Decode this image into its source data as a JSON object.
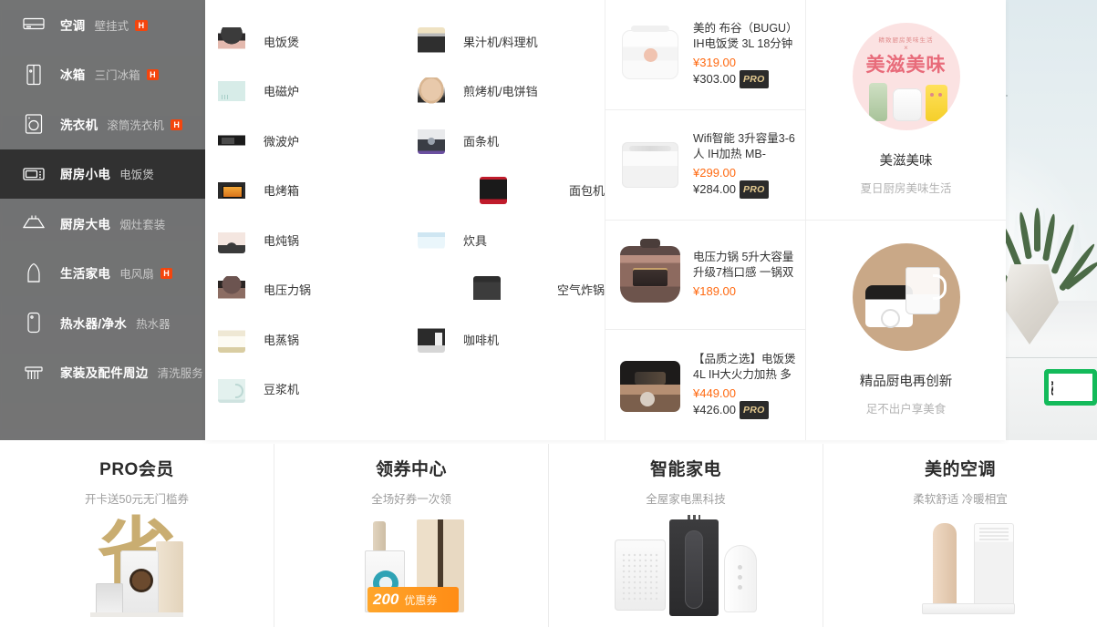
{
  "colors": {
    "hot_badge": "#f4450d",
    "price_now": "#ff6a12",
    "pro_tag_bg": "#2b2b2b",
    "pro_tag_text": "#e3c98f",
    "sidebar_overlay": "rgba(56,56,56,0.68)",
    "active_overlay": "rgba(10,10,10,0.62)",
    "green_box_border": "#13ba5a",
    "promo_pink": "#fbe2e2",
    "promo_tan": "#c9a887",
    "gold_char": "#c5a765"
  },
  "hero": {
    "green_box_text": "城"
  },
  "sidebar": {
    "items": [
      {
        "label": "空调",
        "sub": "壁挂式",
        "hot": "H",
        "icon": "air-conditioner-icon",
        "active": false
      },
      {
        "label": "冰箱",
        "sub": "三门冰箱",
        "hot": "H",
        "icon": "refrigerator-icon",
        "active": false
      },
      {
        "label": "洗衣机",
        "sub": "滚筒洗衣机",
        "hot": "H",
        "icon": "washing-machine-icon",
        "active": false
      },
      {
        "label": "厨房小电",
        "sub": "电饭煲",
        "hot": "",
        "icon": "microwave-icon",
        "active": true
      },
      {
        "label": "厨房大电",
        "sub": "烟灶套装",
        "hot": "",
        "icon": "range-hood-icon",
        "active": false
      },
      {
        "label": "生活家电",
        "sub": "电风扇",
        "hot": "H",
        "icon": "kettle-icon",
        "active": false
      },
      {
        "label": "热水器/净水",
        "sub": "热水器",
        "hot": "",
        "icon": "water-heater-icon",
        "active": false
      },
      {
        "label": "家装及配件周边",
        "sub": "清洗服务",
        "hot": "",
        "icon": "radiator-icon",
        "active": false
      }
    ]
  },
  "flyout": {
    "categories": [
      {
        "label": "电饭煲",
        "thumb": "t-ricecooker",
        "icon": "rice-cooker-thumb"
      },
      {
        "label": "果汁机/料理机",
        "thumb": "t-juicer",
        "icon": "juicer-thumb"
      },
      {
        "label": "电磁炉",
        "thumb": "t-induction",
        "icon": "induction-cooker-thumb"
      },
      {
        "label": "煎烤机/电饼铛",
        "thumb": "t-griddle",
        "icon": "griddle-thumb"
      },
      {
        "label": "微波炉",
        "thumb": "t-microwave",
        "icon": "microwave-thumb"
      },
      {
        "label": "面条机",
        "thumb": "t-noodle",
        "icon": "noodle-maker-thumb"
      },
      {
        "label": "电烤箱",
        "thumb": "t-oven",
        "icon": "electric-oven-thumb"
      },
      {
        "label": "面包机",
        "thumb": "t-bread",
        "icon": "bread-maker-thumb"
      },
      {
        "label": "电炖锅",
        "thumb": "t-stewpot",
        "icon": "stew-pot-thumb"
      },
      {
        "label": "炊具",
        "thumb": "t-cookware",
        "icon": "cookware-thumb"
      },
      {
        "label": "电压力锅",
        "thumb": "t-pressure",
        "icon": "pressure-cooker-thumb"
      },
      {
        "label": "空气炸锅",
        "thumb": "t-airfryer",
        "icon": "air-fryer-thumb"
      },
      {
        "label": "电蒸锅",
        "thumb": "t-steamer",
        "icon": "steamer-thumb"
      },
      {
        "label": "咖啡机",
        "thumb": "t-coffee",
        "icon": "coffee-machine-thumb"
      },
      {
        "label": "豆浆机",
        "thumb": "t-soymilk",
        "icon": "soy-milk-maker-thumb"
      }
    ],
    "products": [
      {
        "title": "美的 布谷（BUGU）IH电饭煲 3L 18分钟",
        "price_now": "¥319.00",
        "price_pro": "¥303.00",
        "pro_tag": "PRO",
        "art": "p-rice1"
      },
      {
        "title": "Wifi智能 3升容量3-6人 IH加热 MB-",
        "price_now": "¥299.00",
        "price_pro": "¥284.00",
        "pro_tag": "PRO",
        "art": "p-rice2"
      },
      {
        "title": "电压力锅 5升大容量升级7档口感 一锅双",
        "price_now": "¥189.00",
        "price_pro": "",
        "pro_tag": "",
        "art": "p-press"
      },
      {
        "title": "【品质之选】电饭煲 4L IH大火力加热 多",
        "price_now": "¥449.00",
        "price_pro": "¥426.00",
        "pro_tag": "PRO",
        "art": "p-rice3"
      }
    ],
    "promos": [
      {
        "arc": "精致厨房美味生活",
        "cross": "×",
        "badge_title": "美滋美味",
        "title": "美滋美味",
        "sub": "夏日厨房美味生活",
        "style": "pink"
      },
      {
        "arc": "",
        "cross": "",
        "badge_title": "",
        "title": "精品厨电再创新",
        "sub": "足不出户享美食",
        "style": "tan"
      }
    ]
  },
  "bottom_cards": [
    {
      "title": "PRO会员",
      "sub": "开卡送50元无门槛券",
      "art": "card-pro-member",
      "gold_char": "省"
    },
    {
      "title": "领券中心",
      "sub": "全场好券一次领",
      "art": "card-coupon-center",
      "coupon_value": "200",
      "coupon_label": "优惠券"
    },
    {
      "title": "智能家电",
      "sub": "全屋家电黑科技",
      "art": "card-smart-home"
    },
    {
      "title": "美的空调",
      "sub": "柔软舒适 冷暖相宜",
      "art": "card-midea-ac"
    }
  ]
}
